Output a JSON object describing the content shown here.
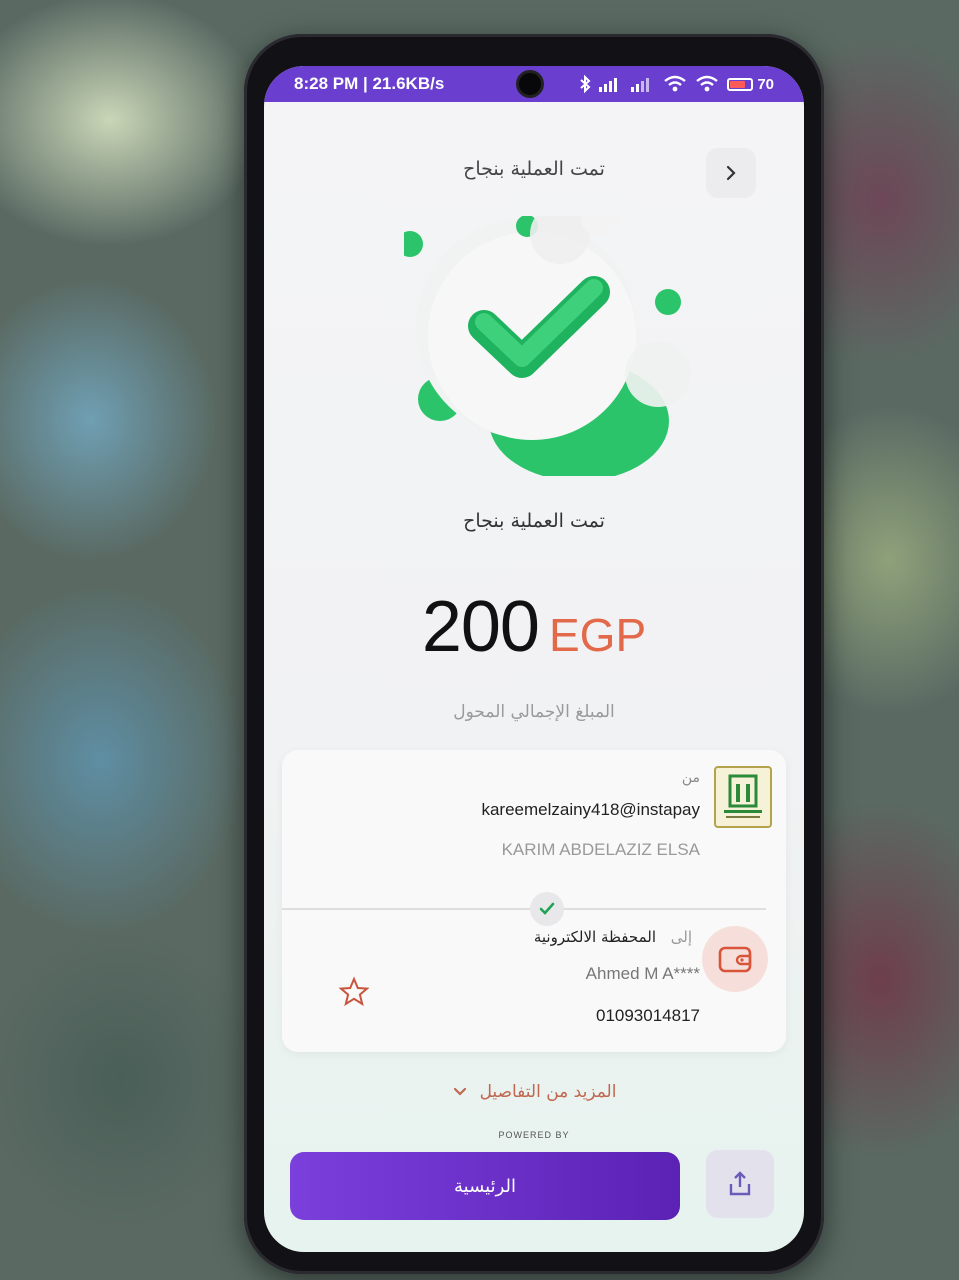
{
  "status_bar": {
    "time_speed": "8:28 PM | 21.6KB/s",
    "battery": "70"
  },
  "header": {
    "title": "تمت العملية بنجاح",
    "back_icon": "chevron-right-icon"
  },
  "result": {
    "icon": "success-check-icon",
    "message": "تمت العملية بنجاح",
    "amount": "200",
    "currency": "EGP",
    "amount_label": "المبلغ الإجمالي المحول"
  },
  "transfer": {
    "from_label": "من",
    "from_handle": "kareemelzainy418@instapay",
    "from_name": "KARIM ABDELAZIZ ELSA",
    "to_label": "إلى",
    "to_wallet": "المحفظة الالكترونية",
    "to_name": "Ahmed M A****",
    "to_phone": "01093014817",
    "bank_icon": "bank-logo",
    "wallet_icon": "wallet-icon",
    "favorite_icon": "star-outline-icon"
  },
  "footer": {
    "more_details": "المزيد من التفاصيل",
    "powered_by": "POWERED BY",
    "home_button": "الرئيسية",
    "share_icon": "share-icon"
  },
  "colors": {
    "status_bar": "#6a3fd0",
    "accent_orange": "#e26a4b",
    "success_green": "#22c55e",
    "primary_button": "#6a30c8"
  }
}
